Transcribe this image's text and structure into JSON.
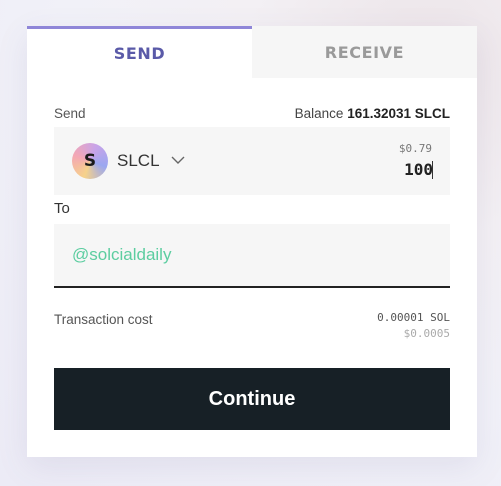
{
  "tabs": [
    {
      "label": "SEND",
      "active": true
    },
    {
      "label": "RECEIVE",
      "active": false
    }
  ],
  "send": {
    "label": "Send",
    "balance_label": "Balance",
    "balance_value": "161.32031 SLCL"
  },
  "token": {
    "symbol": "SLCL",
    "logo_letter": "S",
    "logo_icon": "solcial-logo-icon",
    "dropdown_icon": "chevron-down-icon"
  },
  "amount": {
    "usd_value": "$0.79",
    "value": "100"
  },
  "to": {
    "label": "To",
    "value": "@solcialdaily"
  },
  "transaction": {
    "label": "Transaction cost",
    "sol": "0.00001 SOL",
    "usd": "$0.0005"
  },
  "continue_label": "Continue",
  "colors": {
    "accent": "#5a5aa8",
    "recipient": "#5ccda0",
    "button": "#172026"
  }
}
